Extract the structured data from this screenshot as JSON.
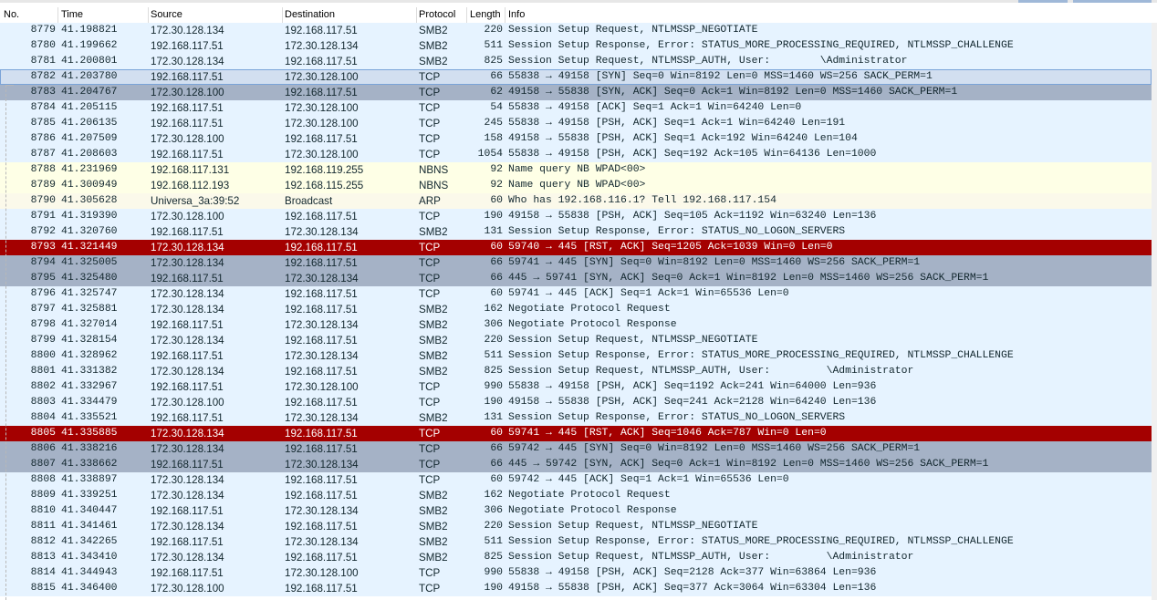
{
  "columns": {
    "no": "No.",
    "time": "Time",
    "source": "Source",
    "destination": "Destination",
    "protocol": "Protocol",
    "length": "Length",
    "info": "Info"
  },
  "colors": {
    "smb_tcp_blue": "#e7e6ff",
    "tcp_light": "#e6f1fb",
    "syn_gray": "#a0a0a0",
    "rst_red": "#a40000",
    "nbns_arp_light": "#fffff0"
  },
  "packets": [
    {
      "no": "8779",
      "time": "41.198821",
      "source": "172.30.128.134",
      "destination": "192.168.117.51",
      "protocol": "SMB2",
      "length": "220",
      "info": "Session Setup Request, NTLMSSP_NEGOTIATE",
      "bg": "#e6f3ff"
    },
    {
      "no": "8780",
      "time": "41.199662",
      "source": "192.168.117.51",
      "destination": "172.30.128.134",
      "protocol": "SMB2",
      "length": "511",
      "info": "Session Setup Response, Error: STATUS_MORE_PROCESSING_REQUIRED, NTLMSSP_CHALLENGE",
      "bg": "#e6f3ff"
    },
    {
      "no": "8781",
      "time": "41.200801",
      "source": "172.30.128.134",
      "destination": "192.168.117.51",
      "protocol": "SMB2",
      "length": "825",
      "info": "Session Setup Request, NTLMSSP_AUTH, User:        \\Administrator",
      "bg": "#e6f3ff"
    },
    {
      "no": "8782",
      "time": "41.203780",
      "source": "192.168.117.51",
      "destination": "172.30.128.100",
      "protocol": "TCP",
      "length": "66",
      "info": "55838 → 49158 [SYN] Seq=0 Win=8192 Len=0 MSS=1460 WS=256 SACK_PERM=1",
      "bg": "#d2dff0",
      "selected": true
    },
    {
      "no": "8783",
      "time": "41.204767",
      "source": "172.30.128.100",
      "destination": "192.168.117.51",
      "protocol": "TCP",
      "length": "62",
      "info": "49158 → 55838 [SYN, ACK] Seq=0 Ack=1 Win=8192 Len=0 MSS=1460 SACK_PERM=1",
      "bg": "#a5b2c6"
    },
    {
      "no": "8784",
      "time": "41.205115",
      "source": "192.168.117.51",
      "destination": "172.30.128.100",
      "protocol": "TCP",
      "length": "54",
      "info": "55838 → 49158 [ACK] Seq=1 Ack=1 Win=64240 Len=0",
      "bg": "#e6f3ff"
    },
    {
      "no": "8785",
      "time": "41.206135",
      "source": "192.168.117.51",
      "destination": "172.30.128.100",
      "protocol": "TCP",
      "length": "245",
      "info": "55838 → 49158 [PSH, ACK] Seq=1 Ack=1 Win=64240 Len=191",
      "bg": "#e6f3ff"
    },
    {
      "no": "8786",
      "time": "41.207509",
      "source": "172.30.128.100",
      "destination": "192.168.117.51",
      "protocol": "TCP",
      "length": "158",
      "info": "49158 → 55838 [PSH, ACK] Seq=1 Ack=192 Win=64240 Len=104",
      "bg": "#e6f3ff"
    },
    {
      "no": "8787",
      "time": "41.208603",
      "source": "192.168.117.51",
      "destination": "172.30.128.100",
      "protocol": "TCP",
      "length": "1054",
      "info": "55838 → 49158 [PSH, ACK] Seq=192 Ack=105 Win=64136 Len=1000",
      "bg": "#e6f3ff"
    },
    {
      "no": "8788",
      "time": "41.231969",
      "source": "192.168.117.131",
      "destination": "192.168.119.255",
      "protocol": "NBNS",
      "length": "92",
      "info": "Name query NB WPAD<00>",
      "bg": "#feffe6"
    },
    {
      "no": "8789",
      "time": "41.300949",
      "source": "192.168.112.193",
      "destination": "192.168.115.255",
      "protocol": "NBNS",
      "length": "92",
      "info": "Name query NB WPAD<00>",
      "bg": "#feffe6"
    },
    {
      "no": "8790",
      "time": "41.305628",
      "source": "Universa_3a:39:52",
      "destination": "Broadcast",
      "protocol": "ARP",
      "length": "60",
      "info": "Who has 192.168.116.1? Tell 192.168.117.154",
      "bg": "#fbf9ea"
    },
    {
      "no": "8791",
      "time": "41.319390",
      "source": "172.30.128.100",
      "destination": "192.168.117.51",
      "protocol": "TCP",
      "length": "190",
      "info": "49158 → 55838 [PSH, ACK] Seq=105 Ack=1192 Win=63240 Len=136",
      "bg": "#e6f3ff"
    },
    {
      "no": "8792",
      "time": "41.320760",
      "source": "192.168.117.51",
      "destination": "172.30.128.134",
      "protocol": "SMB2",
      "length": "131",
      "info": "Session Setup Response, Error: STATUS_NO_LOGON_SERVERS",
      "bg": "#e6f3ff"
    },
    {
      "no": "8793",
      "time": "41.321449",
      "source": "172.30.128.134",
      "destination": "192.168.117.51",
      "protocol": "TCP",
      "length": "60",
      "info": "59740 → 445 [RST, ACK] Seq=1205 Ack=1039 Win=0 Len=0",
      "bg": "#a40000",
      "highlight": true
    },
    {
      "no": "8794",
      "time": "41.325005",
      "source": "172.30.128.134",
      "destination": "192.168.117.51",
      "protocol": "TCP",
      "length": "66",
      "info": "59741 → 445 [SYN] Seq=0 Win=8192 Len=0 MSS=1460 WS=256 SACK_PERM=1",
      "bg": "#a5b2c6"
    },
    {
      "no": "8795",
      "time": "41.325480",
      "source": "192.168.117.51",
      "destination": "172.30.128.134",
      "protocol": "TCP",
      "length": "66",
      "info": "445 → 59741 [SYN, ACK] Seq=0 Ack=1 Win=8192 Len=0 MSS=1460 WS=256 SACK_PERM=1",
      "bg": "#a5b2c6"
    },
    {
      "no": "8796",
      "time": "41.325747",
      "source": "172.30.128.134",
      "destination": "192.168.117.51",
      "protocol": "TCP",
      "length": "60",
      "info": "59741 → 445 [ACK] Seq=1 Ack=1 Win=65536 Len=0",
      "bg": "#e6f3ff"
    },
    {
      "no": "8797",
      "time": "41.325881",
      "source": "172.30.128.134",
      "destination": "192.168.117.51",
      "protocol": "SMB2",
      "length": "162",
      "info": "Negotiate Protocol Request",
      "bg": "#e6f3ff"
    },
    {
      "no": "8798",
      "time": "41.327014",
      "source": "192.168.117.51",
      "destination": "172.30.128.134",
      "protocol": "SMB2",
      "length": "306",
      "info": "Negotiate Protocol Response",
      "bg": "#e6f3ff"
    },
    {
      "no": "8799",
      "time": "41.328154",
      "source": "172.30.128.134",
      "destination": "192.168.117.51",
      "protocol": "SMB2",
      "length": "220",
      "info": "Session Setup Request, NTLMSSP_NEGOTIATE",
      "bg": "#e6f3ff"
    },
    {
      "no": "8800",
      "time": "41.328962",
      "source": "192.168.117.51",
      "destination": "172.30.128.134",
      "protocol": "SMB2",
      "length": "511",
      "info": "Session Setup Response, Error: STATUS_MORE_PROCESSING_REQUIRED, NTLMSSP_CHALLENGE",
      "bg": "#e6f3ff"
    },
    {
      "no": "8801",
      "time": "41.331382",
      "source": "172.30.128.134",
      "destination": "192.168.117.51",
      "protocol": "SMB2",
      "length": "825",
      "info": "Session Setup Request, NTLMSSP_AUTH, User:         \\Administrator",
      "bg": "#e6f3ff"
    },
    {
      "no": "8802",
      "time": "41.332967",
      "source": "192.168.117.51",
      "destination": "172.30.128.100",
      "protocol": "TCP",
      "length": "990",
      "info": "55838 → 49158 [PSH, ACK] Seq=1192 Ack=241 Win=64000 Len=936",
      "bg": "#e6f3ff"
    },
    {
      "no": "8803",
      "time": "41.334479",
      "source": "172.30.128.100",
      "destination": "192.168.117.51",
      "protocol": "TCP",
      "length": "190",
      "info": "49158 → 55838 [PSH, ACK] Seq=241 Ack=2128 Win=64240 Len=136",
      "bg": "#e6f3ff"
    },
    {
      "no": "8804",
      "time": "41.335521",
      "source": "192.168.117.51",
      "destination": "172.30.128.134",
      "protocol": "SMB2",
      "length": "131",
      "info": "Session Setup Response, Error: STATUS_NO_LOGON_SERVERS",
      "bg": "#e6f3ff"
    },
    {
      "no": "8805",
      "time": "41.335885",
      "source": "172.30.128.134",
      "destination": "192.168.117.51",
      "protocol": "TCP",
      "length": "60",
      "info": "59741 → 445 [RST, ACK] Seq=1046 Ack=787 Win=0 Len=0",
      "bg": "#a40000",
      "highlight": true
    },
    {
      "no": "8806",
      "time": "41.338216",
      "source": "172.30.128.134",
      "destination": "192.168.117.51",
      "protocol": "TCP",
      "length": "66",
      "info": "59742 → 445 [SYN] Seq=0 Win=8192 Len=0 MSS=1460 WS=256 SACK_PERM=1",
      "bg": "#a5b2c6"
    },
    {
      "no": "8807",
      "time": "41.338662",
      "source": "192.168.117.51",
      "destination": "172.30.128.134",
      "protocol": "TCP",
      "length": "66",
      "info": "445 → 59742 [SYN, ACK] Seq=0 Ack=1 Win=8192 Len=0 MSS=1460 WS=256 SACK_PERM=1",
      "bg": "#a5b2c6"
    },
    {
      "no": "8808",
      "time": "41.338897",
      "source": "172.30.128.134",
      "destination": "192.168.117.51",
      "protocol": "TCP",
      "length": "60",
      "info": "59742 → 445 [ACK] Seq=1 Ack=1 Win=65536 Len=0",
      "bg": "#e6f3ff"
    },
    {
      "no": "8809",
      "time": "41.339251",
      "source": "172.30.128.134",
      "destination": "192.168.117.51",
      "protocol": "SMB2",
      "length": "162",
      "info": "Negotiate Protocol Request",
      "bg": "#e6f3ff"
    },
    {
      "no": "8810",
      "time": "41.340447",
      "source": "192.168.117.51",
      "destination": "172.30.128.134",
      "protocol": "SMB2",
      "length": "306",
      "info": "Negotiate Protocol Response",
      "bg": "#e6f3ff"
    },
    {
      "no": "8811",
      "time": "41.341461",
      "source": "172.30.128.134",
      "destination": "192.168.117.51",
      "protocol": "SMB2",
      "length": "220",
      "info": "Session Setup Request, NTLMSSP_NEGOTIATE",
      "bg": "#e6f3ff"
    },
    {
      "no": "8812",
      "time": "41.342265",
      "source": "192.168.117.51",
      "destination": "172.30.128.134",
      "protocol": "SMB2",
      "length": "511",
      "info": "Session Setup Response, Error: STATUS_MORE_PROCESSING_REQUIRED, NTLMSSP_CHALLENGE",
      "bg": "#e6f3ff"
    },
    {
      "no": "8813",
      "time": "41.343410",
      "source": "172.30.128.134",
      "destination": "192.168.117.51",
      "protocol": "SMB2",
      "length": "825",
      "info": "Session Setup Request, NTLMSSP_AUTH, User:         \\Administrator",
      "bg": "#e6f3ff"
    },
    {
      "no": "8814",
      "time": "41.344943",
      "source": "192.168.117.51",
      "destination": "172.30.128.100",
      "protocol": "TCP",
      "length": "990",
      "info": "55838 → 49158 [PSH, ACK] Seq=2128 Ack=377 Win=63864 Len=936",
      "bg": "#e6f3ff"
    },
    {
      "no": "8815",
      "time": "41.346400",
      "source": "172.30.128.100",
      "destination": "192.168.117.51",
      "protocol": "TCP",
      "length": "190",
      "info": "49158 → 55838 [PSH, ACK] Seq=377 Ack=3064 Win=63304 Len=136",
      "bg": "#e6f3ff"
    }
  ]
}
